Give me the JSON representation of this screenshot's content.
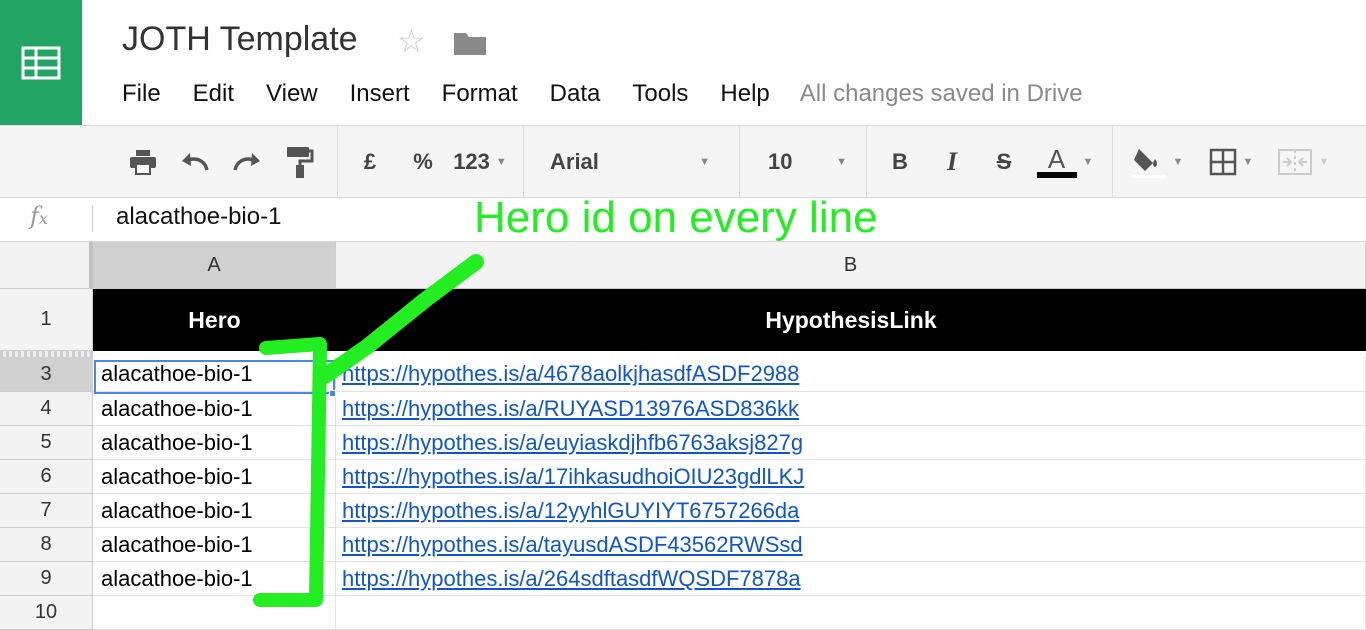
{
  "document": {
    "title": "JOTH Template",
    "save_status": "All changes saved in Drive"
  },
  "menu": [
    "File",
    "Edit",
    "View",
    "Insert",
    "Format",
    "Data",
    "Tools",
    "Help"
  ],
  "toolbar": {
    "currency_label": "£",
    "percent_label": "%",
    "number_format_label": "123",
    "font_family": "Arial",
    "font_size": "10",
    "bold_label": "B",
    "italic_label": "I",
    "strike_label": "S",
    "text_color_label": "A",
    "text_color": "#000000"
  },
  "formula_bar": {
    "value": "alacathoe-bio-1"
  },
  "columns": [
    "A",
    "B"
  ],
  "header_row": {
    "row_number": "1",
    "hero": "Hero",
    "link": "HypothesisLink"
  },
  "rows": [
    {
      "row_number": "3",
      "hero": "alacathoe-bio-1",
      "link": "https://hypothes.is/a/4678aolkjhasdfASDF2988"
    },
    {
      "row_number": "4",
      "hero": "alacathoe-bio-1",
      "link": "https://hypothes.is/a/RUYASD13976ASD836kk"
    },
    {
      "row_number": "5",
      "hero": "alacathoe-bio-1",
      "link": "https://hypothes.is/a/euyiaskdjhfb6763aksj827g"
    },
    {
      "row_number": "6",
      "hero": "alacathoe-bio-1",
      "link": "https://hypothes.is/a/17ihkasudhoiOIU23gdlLKJ"
    },
    {
      "row_number": "7",
      "hero": "alacathoe-bio-1",
      "link": "https://hypothes.is/a/12yyhlGUYIYT6757266da"
    },
    {
      "row_number": "8",
      "hero": "alacathoe-bio-1",
      "link": "https://hypothes.is/a/tayusdASDF43562RWSsd"
    },
    {
      "row_number": "9",
      "hero": "alacathoe-bio-1",
      "link": "https://hypothes.is/a/264sdftasdfWQSDF7878a"
    },
    {
      "row_number": "10",
      "hero": "",
      "link": ""
    }
  ],
  "annotation": {
    "text": "Hero id on every line",
    "color": "#22ee22"
  },
  "colors": {
    "brand": "#21a464",
    "link": "#1155cc",
    "selection": "#4a86e8"
  }
}
